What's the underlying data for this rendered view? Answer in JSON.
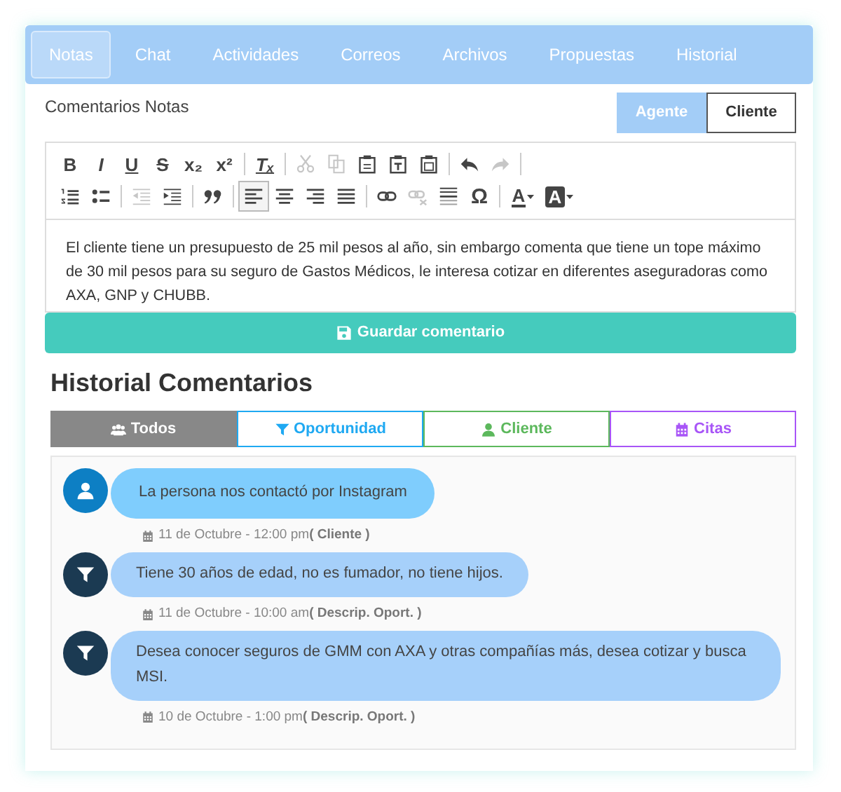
{
  "tabs": [
    {
      "label": "Notas",
      "selected": true
    },
    {
      "label": "Chat",
      "selected": false
    },
    {
      "label": "Actividades",
      "selected": false
    },
    {
      "label": "Correos",
      "selected": false
    },
    {
      "label": "Archivos",
      "selected": false
    },
    {
      "label": "Propuestas",
      "selected": false
    },
    {
      "label": "Historial",
      "selected": false
    }
  ],
  "section_label": "Comentarios Notas",
  "author_toggle": [
    {
      "label": "Agente",
      "selected": true
    },
    {
      "label": "Cliente",
      "selected": false
    }
  ],
  "toolbar": [
    [
      [
        {
          "kind": "bold",
          "label": "B",
          "disabled": false
        },
        {
          "kind": "italic",
          "label": "I",
          "disabled": false
        },
        {
          "kind": "underline",
          "label": "U",
          "disabled": false
        },
        {
          "kind": "strike",
          "label": "S",
          "disabled": false
        },
        {
          "kind": "subscript",
          "label": "x₂",
          "disabled": false
        },
        {
          "kind": "superscript",
          "label": "x²",
          "disabled": false
        }
      ],
      [
        {
          "kind": "remove-format",
          "label": "Tₓ",
          "disabled": false
        }
      ],
      [
        {
          "kind": "cut",
          "disabled": true
        },
        {
          "kind": "copy",
          "disabled": true
        },
        {
          "kind": "paste",
          "disabled": false
        },
        {
          "kind": "paste-text",
          "disabled": false
        },
        {
          "kind": "paste-word",
          "disabled": false
        }
      ],
      [
        {
          "kind": "undo",
          "disabled": false
        },
        {
          "kind": "redo",
          "disabled": true
        }
      ]
    ],
    [
      [
        {
          "kind": "ordered-list",
          "disabled": false
        },
        {
          "kind": "bullet-list",
          "disabled": false
        }
      ],
      [
        {
          "kind": "outdent",
          "disabled": true
        },
        {
          "kind": "indent",
          "disabled": false
        }
      ],
      [
        {
          "kind": "quote",
          "disabled": false
        }
      ],
      [
        {
          "kind": "align-left",
          "disabled": false,
          "selected": true
        },
        {
          "kind": "align-center",
          "disabled": false,
          "selected": false
        },
        {
          "kind": "align-right",
          "disabled": false,
          "selected": false
        },
        {
          "kind": "justify",
          "disabled": false,
          "selected": false
        }
      ],
      [
        {
          "kind": "link",
          "disabled": false
        },
        {
          "kind": "unlink",
          "disabled": true
        },
        {
          "kind": "horizontal-rule",
          "disabled": false
        },
        {
          "kind": "special-char",
          "label": "Ω",
          "disabled": false
        }
      ],
      [
        {
          "kind": "text-color",
          "label": "A",
          "disabled": false
        },
        {
          "kind": "background-color",
          "label": "A",
          "disabled": false
        }
      ]
    ]
  ],
  "editor_text": "El cliente tiene un presupuesto de 25 mil pesos al año, sin embargo comenta que tiene un tope máximo de 30 mil pesos para su seguro de Gastos Médicos, le interesa cotizar en diferentes aseguradoras como AXA, GNP y CHUBB.",
  "save_button": "Guardar comentario",
  "history_title": "Historial Comentarios",
  "filters": [
    {
      "kind": "all",
      "label": "Todos",
      "color": "#888888",
      "selected": true
    },
    {
      "kind": "opportunity",
      "label": "Oportunidad",
      "color": "#1fa9f2",
      "selected": false
    },
    {
      "kind": "client",
      "label": "Cliente",
      "color": "#5cb85c",
      "selected": false
    },
    {
      "kind": "appointment",
      "label": "Citas",
      "color": "#a855f7",
      "selected": false
    }
  ],
  "comments": [
    {
      "kind": "client",
      "text": "La persona nos contactó por Instagram",
      "date": "11 de Octubre - 12:00 pm",
      "source": "( Cliente )"
    },
    {
      "kind": "opportunity",
      "text": "Tiene 30 años de edad, no es fumador, no tiene hijos.",
      "date": "11 de Octubre - 10:00 am",
      "source": "( Descrip. Oport. )"
    },
    {
      "kind": "opportunity",
      "text": "Desea conocer seguros de GMM con AXA y otras compañías más, desea cotizar y busca MSI.",
      "date": "10 de Octubre - 1:00 pm",
      "source": "( Descrip. Oport. )"
    }
  ]
}
